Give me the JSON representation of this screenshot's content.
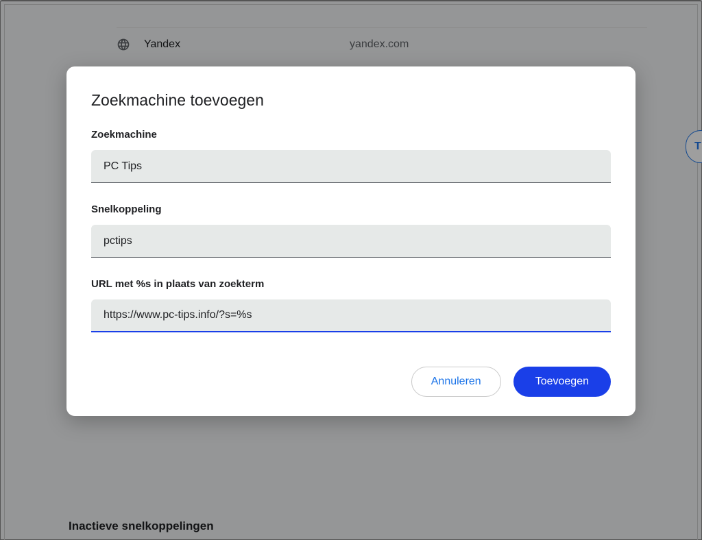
{
  "background": {
    "row": {
      "name": "Yandex",
      "domain": "yandex.com"
    },
    "section_heading": "Inactieve snelkoppelingen",
    "right_pill_char": "T"
  },
  "dialog": {
    "title": "Zoekmachine toevoegen",
    "fields": {
      "name": {
        "label": "Zoekmachine",
        "value": "PC Tips"
      },
      "shortcut": {
        "label": "Snelkoppeling",
        "value": "pctips"
      },
      "url": {
        "label": "URL met %s in plaats van zoekterm",
        "value": "https://www.pc-tips.info/?s=%s"
      }
    },
    "buttons": {
      "cancel": "Annuleren",
      "add": "Toevoegen"
    }
  }
}
